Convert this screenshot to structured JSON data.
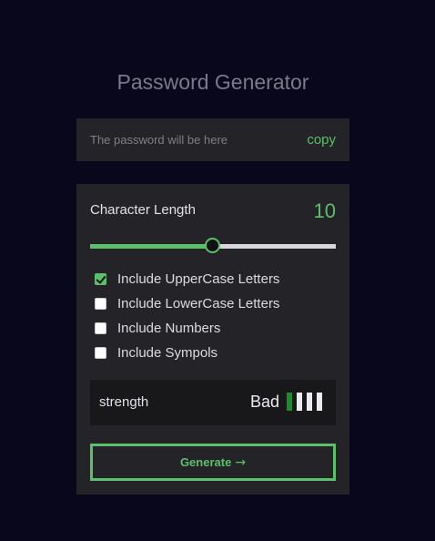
{
  "app": {
    "title": "Password Generator"
  },
  "output": {
    "placeholder": "The password will be here",
    "copy_label": "copy"
  },
  "length": {
    "label": "Character Length",
    "value": "10",
    "slider_fraction": 0.5
  },
  "options": [
    {
      "label": "Include UpperCase Letters",
      "checked": true
    },
    {
      "label": "Include LowerCase Letters",
      "checked": false
    },
    {
      "label": "Include Numbers",
      "checked": false
    },
    {
      "label": "Include Sympols",
      "checked": false
    }
  ],
  "strength": {
    "label": "strength",
    "value": "Bad",
    "level": 1,
    "max_level": 4
  },
  "generate": {
    "label": "Generate",
    "icon": "arrow-right-icon",
    "glyph": "→"
  },
  "colors": {
    "background": "#08071c",
    "panel": "#242428",
    "accent": "#5cbf6b",
    "strength_on": "#1f8a2e"
  }
}
